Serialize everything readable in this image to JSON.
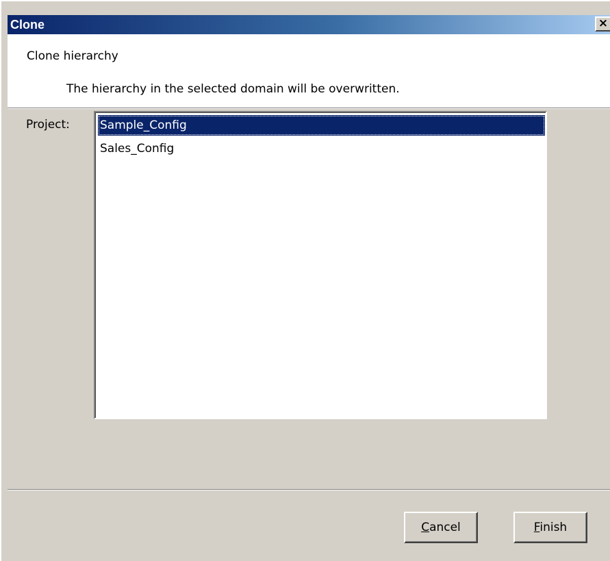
{
  "window": {
    "title": "Clone",
    "close_glyph": "×"
  },
  "header": {
    "title": "Clone hierarchy",
    "description": "The hierarchy in the selected domain will be overwritten."
  },
  "project": {
    "label": "Project:",
    "items": [
      {
        "label": "Sample_Config",
        "selected": true
      },
      {
        "label": "Sales_Config",
        "selected": false
      }
    ]
  },
  "buttons": {
    "cancel": {
      "mnemonic": "C",
      "rest": "ancel"
    },
    "finish": {
      "mnemonic": "F",
      "rest": "inish"
    }
  },
  "colors": {
    "titlebar_start": "#0a246a",
    "titlebar_end": "#a6caf0",
    "selection": "#0a246a",
    "face": "#d4d0c8"
  }
}
